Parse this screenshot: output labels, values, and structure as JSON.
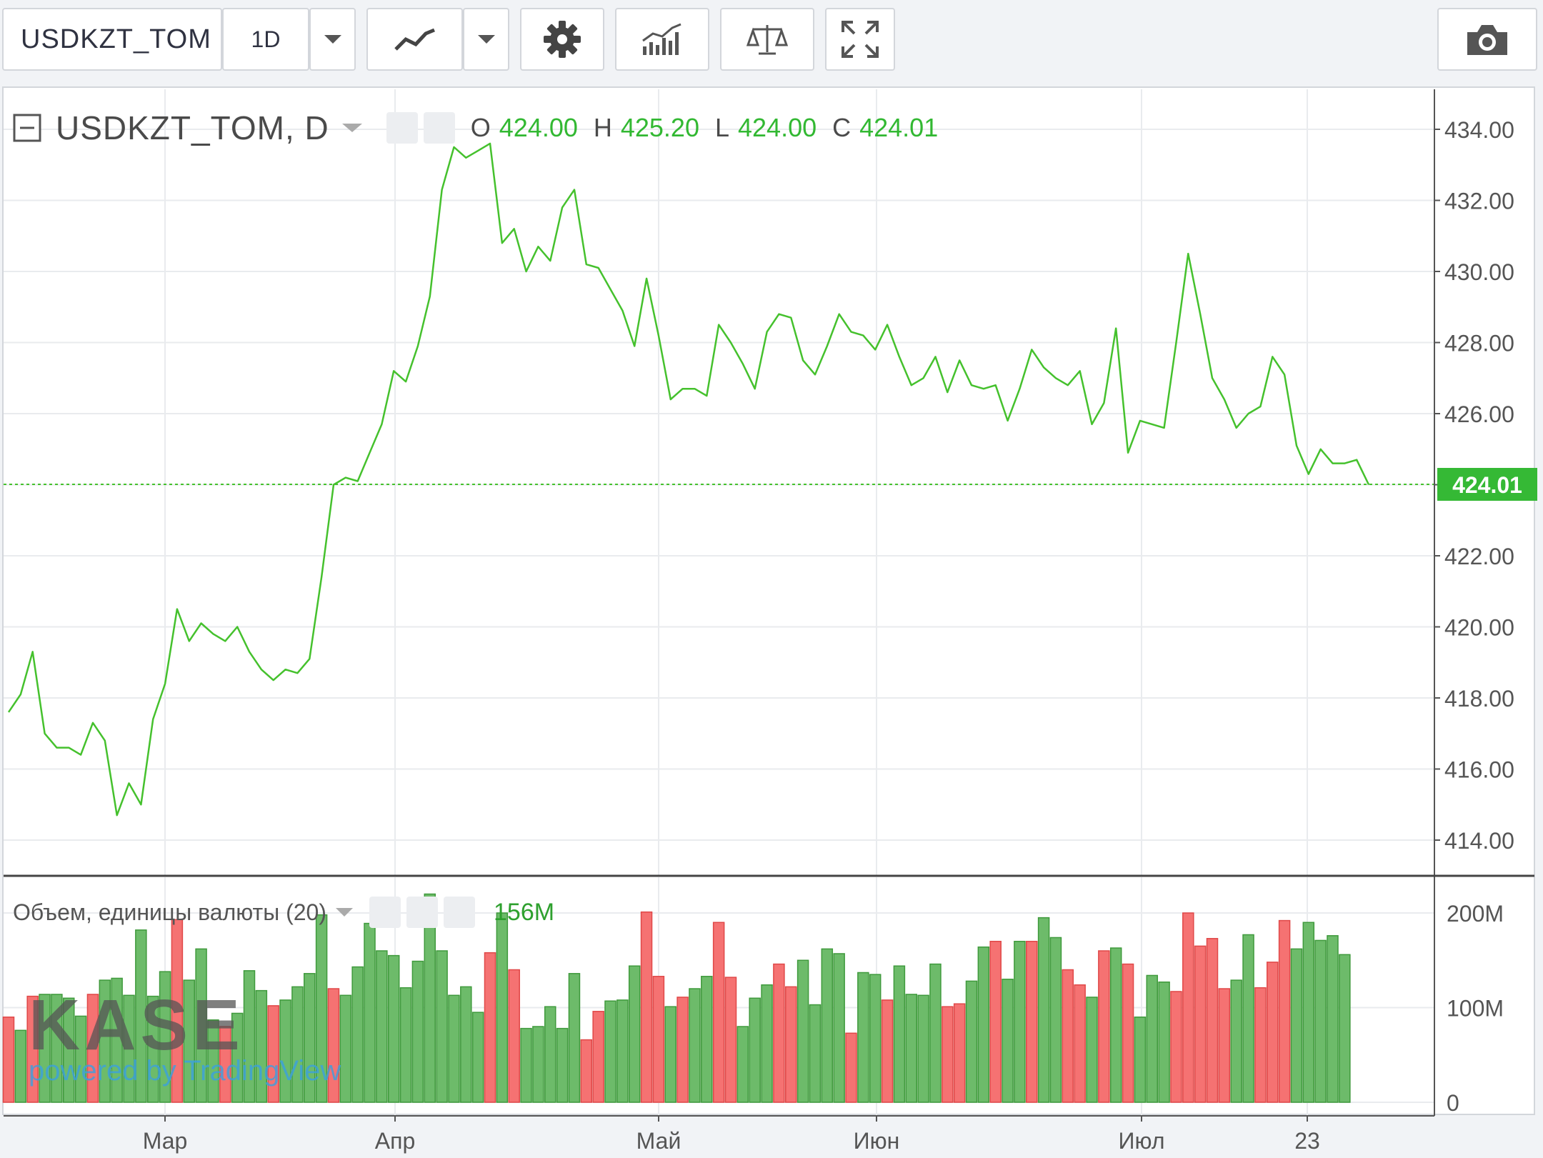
{
  "toolbar": {
    "symbol": "USDKZT_TOM",
    "interval": "1D",
    "icons": [
      "chevron-down-icon",
      "line-chart-icon",
      "chevron-down-icon",
      "gear-icon",
      "indicators-icon",
      "compare-scales-icon",
      "fullscreen-icon",
      "camera-icon"
    ]
  },
  "legend": {
    "title": "USDKZT_TOM, D",
    "open_label": "O",
    "open": "424.00",
    "high_label": "H",
    "high": "425.20",
    "low_label": "L",
    "low": "424.00",
    "close_label": "C",
    "close": "424.01"
  },
  "volume_legend": {
    "title": "Объем, единицы валюты (20)",
    "value": "156M"
  },
  "watermark": {
    "logo": "KASE",
    "powered": "powered by TradingView"
  },
  "colors": {
    "line": "#45c12d",
    "up_volume": "#6dbb6a",
    "down_volume": "#f57272",
    "price_tag": "#35b935",
    "grid": "#e9ebee"
  },
  "chart_data": [
    {
      "type": "line",
      "title": "USDKZT_TOM, D",
      "x_ticks": [
        "Мар",
        "Апр",
        "Май",
        "Июн",
        "Июл",
        "23"
      ],
      "y_ticks": [
        "414.00",
        "416.00",
        "418.00",
        "420.00",
        "422.00",
        "424.00",
        "426.00",
        "428.00",
        "430.00",
        "432.00",
        "434.00"
      ],
      "ylim": [
        412.9,
        434.9
      ],
      "grid": true,
      "last_value": 424.01,
      "last_value_label": "424.01",
      "values": [
        417.6,
        418.1,
        419.3,
        417.0,
        416.6,
        416.6,
        416.4,
        417.3,
        416.8,
        414.7,
        415.6,
        415.0,
        417.4,
        418.4,
        420.5,
        419.6,
        420.1,
        419.8,
        419.6,
        420.0,
        419.3,
        418.8,
        418.5,
        418.8,
        418.7,
        419.1,
        421.4,
        424.0,
        424.2,
        424.1,
        424.9,
        425.7,
        427.2,
        426.9,
        427.9,
        429.3,
        432.3,
        433.5,
        433.2,
        433.4,
        433.6,
        430.8,
        431.2,
        430.0,
        430.7,
        430.3,
        431.8,
        432.3,
        430.2,
        430.1,
        429.5,
        428.9,
        427.9,
        429.8,
        428.2,
        426.4,
        426.7,
        426.7,
        426.5,
        428.5,
        428.0,
        427.4,
        426.7,
        428.3,
        428.8,
        428.7,
        427.5,
        427.1,
        427.9,
        428.8,
        428.3,
        428.2,
        427.8,
        428.5,
        427.6,
        426.8,
        427.0,
        427.6,
        426.6,
        427.5,
        426.8,
        426.7,
        426.8,
        425.8,
        426.7,
        427.8,
        427.3,
        427.0,
        426.8,
        427.2,
        425.7,
        426.3,
        428.4,
        424.9,
        425.8,
        425.7,
        425.6,
        428.0,
        430.5,
        428.8,
        427.0,
        426.4,
        425.6,
        426.0,
        426.2,
        427.6,
        427.1,
        425.1,
        424.3,
        425.0,
        424.6,
        424.6,
        424.7,
        424.0
      ]
    },
    {
      "type": "bar",
      "title": "Объем, единицы валюты (20)",
      "y_ticks": [
        "0",
        "100M",
        "200M"
      ],
      "ylim": [
        0,
        236
      ],
      "grid": true,
      "last_value_label": "156M",
      "series": [
        {
          "values": [
            90,
            76,
            112,
            114,
            114,
            110,
            91,
            114,
            129,
            131,
            113,
            182,
            112,
            138,
            193,
            129,
            162,
            87,
            80,
            94,
            139,
            118,
            102,
            108,
            122,
            136,
            198,
            120,
            113,
            143,
            189,
            160,
            155,
            121,
            149,
            220,
            160,
            113,
            122,
            95,
            158,
            200,
            140,
            78,
            80,
            101,
            78,
            136,
            66,
            96,
            107,
            108,
            144,
            201,
            133,
            101,
            111,
            120,
            133,
            190,
            132,
            80,
            110,
            124,
            146,
            122,
            150,
            103,
            162,
            157,
            73,
            137,
            135,
            108,
            144,
            114,
            113,
            146,
            101,
            104,
            128,
            164,
            170,
            130,
            170,
            170,
            195,
            174,
            140,
            124,
            111,
            160,
            163,
            146,
            90,
            134,
            127,
            117,
            200,
            165,
            173,
            120,
            129,
            177,
            121,
            148,
            192,
            162,
            190,
            171,
            176,
            156
          ],
          "directions": [
            "down",
            "up",
            "down",
            "up",
            "up",
            "up",
            "up",
            "down",
            "up",
            "up",
            "up",
            "up",
            "up",
            "up",
            "down",
            "up",
            "up",
            "up",
            "down",
            "up",
            "up",
            "up",
            "down",
            "up",
            "up",
            "up",
            "up",
            "down",
            "up",
            "up",
            "up",
            "up",
            "up",
            "up",
            "up",
            "up",
            "up",
            "up",
            "up",
            "up",
            "down",
            "up",
            "down",
            "up",
            "up",
            "up",
            "up",
            "up",
            "down",
            "down",
            "up",
            "up",
            "up",
            "down",
            "down",
            "up",
            "down",
            "up",
            "up",
            "down",
            "down",
            "up",
            "up",
            "up",
            "down",
            "down",
            "up",
            "up",
            "up",
            "up",
            "down",
            "up",
            "up",
            "down",
            "up",
            "up",
            "up",
            "up",
            "down",
            "down",
            "up",
            "up",
            "down",
            "up",
            "up",
            "down",
            "up",
            "up",
            "down",
            "down",
            "up",
            "down",
            "up",
            "down",
            "up",
            "up",
            "up",
            "down",
            "down",
            "down",
            "down",
            "down",
            "up",
            "up",
            "down",
            "down",
            "down",
            "up",
            "up",
            "up",
            "up",
            "up"
          ]
        }
      ]
    }
  ]
}
